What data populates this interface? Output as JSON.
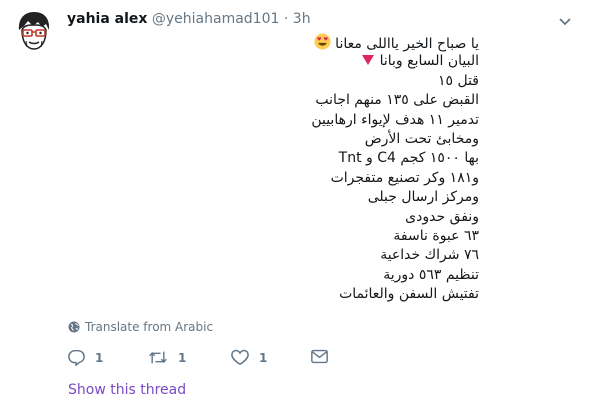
{
  "tweet": {
    "author_name": "yahia alex",
    "handle": "@yehiahamad101",
    "separator": "·",
    "time": "3h",
    "lines": [
      "يا صباح الخير يااللى معانا",
      "البيان السابع وبانا",
      "قتل ١٥",
      "القبض على ١٣٥ منهم اجانب",
      "تدمير ١١ هدف لإيواء ارهابيين",
      "ومخابئ تحت  الأرض",
      "بها ١٥٠٠ كجم  C4 و Tnt",
      "و١٨١ وكر تصنيع متفجرات",
      "ومركز ارسال جبلى",
      "ونفق حدودى",
      "٦٣ عبوة ناسفة",
      "٧٦ شراك خداعية",
      "تنظيم ٥٦٣ دورية",
      "تفتيش السفن والعائمات"
    ],
    "translate_label": "Translate from Arabic",
    "reply_count": "1",
    "retweet_count": "1",
    "like_count": "1",
    "show_thread_label": "Show this thread"
  },
  "colors": {
    "text": "#14171a",
    "secondary": "#657786",
    "thread_link": "#794bc4",
    "emoji_face": "#ffcc4d",
    "emoji_heart": "#e0245e"
  },
  "icons": {
    "avatar": "cartoon-avatar",
    "caret": "chevron-down-icon",
    "translate": "globe-icon",
    "reply": "reply-icon",
    "retweet": "retweet-icon",
    "like": "heart-icon",
    "message": "envelope-icon"
  }
}
